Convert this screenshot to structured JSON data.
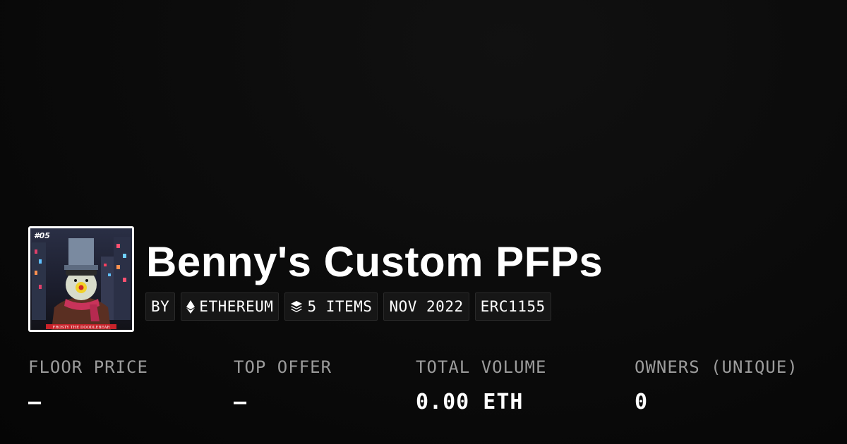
{
  "collection": {
    "title": "Benny's Custom PFPs",
    "avatar": {
      "icon": "collection-avatar-image",
      "badge_text": "#05",
      "caption_text": "FROSTY THE DOODLEBEAR"
    }
  },
  "chips": [
    {
      "label": "BY",
      "icon": null
    },
    {
      "label": "ETHEREUM",
      "icon": "ethereum-icon"
    },
    {
      "label": "5 ITEMS",
      "icon": "layers-icon"
    },
    {
      "label": "NOV 2022",
      "icon": null
    },
    {
      "label": "ERC1155",
      "icon": null
    }
  ],
  "stats": [
    {
      "label": "FLOOR PRICE",
      "value": "–"
    },
    {
      "label": "TOP OFFER",
      "value": "–"
    },
    {
      "label": "TOTAL VOLUME",
      "value": "0.00 ETH"
    },
    {
      "label": "OWNERS (UNIQUE)",
      "value": "0"
    }
  ],
  "colors": {
    "background": "#0a0a0a",
    "text": "#ffffff",
    "muted_label": "#9c9c9c",
    "chip_background": "#161616"
  }
}
